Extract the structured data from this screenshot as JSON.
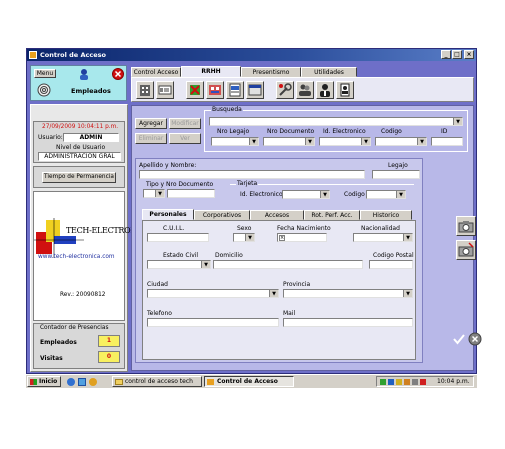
{
  "window": {
    "title": "Control de Acceso"
  },
  "header": {
    "menu_label": "Menu",
    "module_title": "Empleados"
  },
  "main_tabs": [
    "Control Acceso",
    "RRHH",
    "Presentismo",
    "Utilidades"
  ],
  "left_panel": {
    "datetime": "27/09/2009 10:04:11 p.m.",
    "usuario_label": "Usuario:",
    "usuario_value": "ADMIN",
    "nivel_label": "Nivel de Usuario",
    "nivel_value": "ADMINISTRACION GRAL",
    "tiempo_button": "Tiempo de Permanencia",
    "logo_text": "TECH-ELECTRONICA",
    "website": "www.tech-electronica.com",
    "rev": "Rev.: 20090812",
    "contador_title": "Contador de Presencias",
    "empleados_label": "Empleados",
    "empleados_count": "1",
    "visitas_label": "Visitas",
    "visitas_count": "0"
  },
  "actions": {
    "agregar": "Agregar",
    "modificar": "Modificar",
    "eliminar": "Eliminar",
    "ver": "Ver"
  },
  "busqueda": {
    "title": "Busqueda",
    "nro_legajo": "Nro Legajo",
    "nro_documento": "Nro Documento",
    "id_electronico": "Id. Electronico",
    "codigo": "Codigo",
    "id": "ID"
  },
  "form": {
    "apellido_nombre": "Apellido y Nombre:",
    "legajo": "Legajo",
    "tipo_nro_documento": "Tipo y Nro Documento",
    "tarjeta": "Tarjeta",
    "id_electronico": "Id. Electronico:",
    "codigo": "Codigo :"
  },
  "sub_tabs": [
    "Personales",
    "Corporativos",
    "Accesos",
    "Rot. Perf. Acc.",
    "Historico"
  ],
  "personales": {
    "cuil": "C.U.I.L.",
    "sexo": "Sexo",
    "fecha_nacimiento": "Fecha Nacimiento",
    "nacionalidad": "Nacionalidad",
    "estado_civil": "Estado Civil",
    "domicilio": "Domicilio",
    "codigo_postal": "Codigo Postal",
    "ciudad": "Ciudad",
    "provincia": "Provincia",
    "telefono": "Telefono",
    "mail": "Mail"
  },
  "taskbar": {
    "start": "Inicio",
    "task1": "control de acceso tech",
    "task2": "Control de Acceso",
    "clock": "10:04 p.m."
  },
  "colors": {
    "window_bg": "#6e6fc8",
    "form_bg": "#c8c8ec",
    "accent_red": "#d01010"
  }
}
